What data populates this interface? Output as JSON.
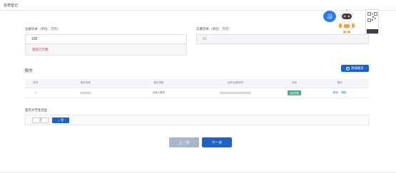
{
  "header": {
    "title": "名称登记"
  },
  "registered_capital": {
    "label": "注册资本（单位：万元）",
    "value": "100",
    "hint": "壹佰万元整"
  },
  "paid_in_capital": {
    "label": "实缴资本（单位：万元）",
    "value": "50"
  },
  "shareholders": {
    "title": "股东",
    "add_button_label": "添加股东",
    "columns": [
      "序号",
      "股东名称",
      "股东类型",
      "证件/证照号码",
      "状态",
      "操作"
    ],
    "rows": [
      {
        "index": "1",
        "type": "自然人股东",
        "status": "信息完整",
        "edit": "修改",
        "delete": "删除"
      }
    ]
  },
  "college_student": {
    "label": "是否大学生创业",
    "option_no": "否",
    "option_yes": "是",
    "selected": "是"
  },
  "nav": {
    "prev_label": "上一步",
    "next_label": "下一步"
  },
  "assistant": {
    "bubble_text_1": "小当",
    "bubble_text_2": "问我"
  },
  "colors": {
    "primary": "#1e63c4",
    "success": "#3fb38a",
    "warning": "#e23c3c",
    "disabled": "#a9b6cb"
  }
}
